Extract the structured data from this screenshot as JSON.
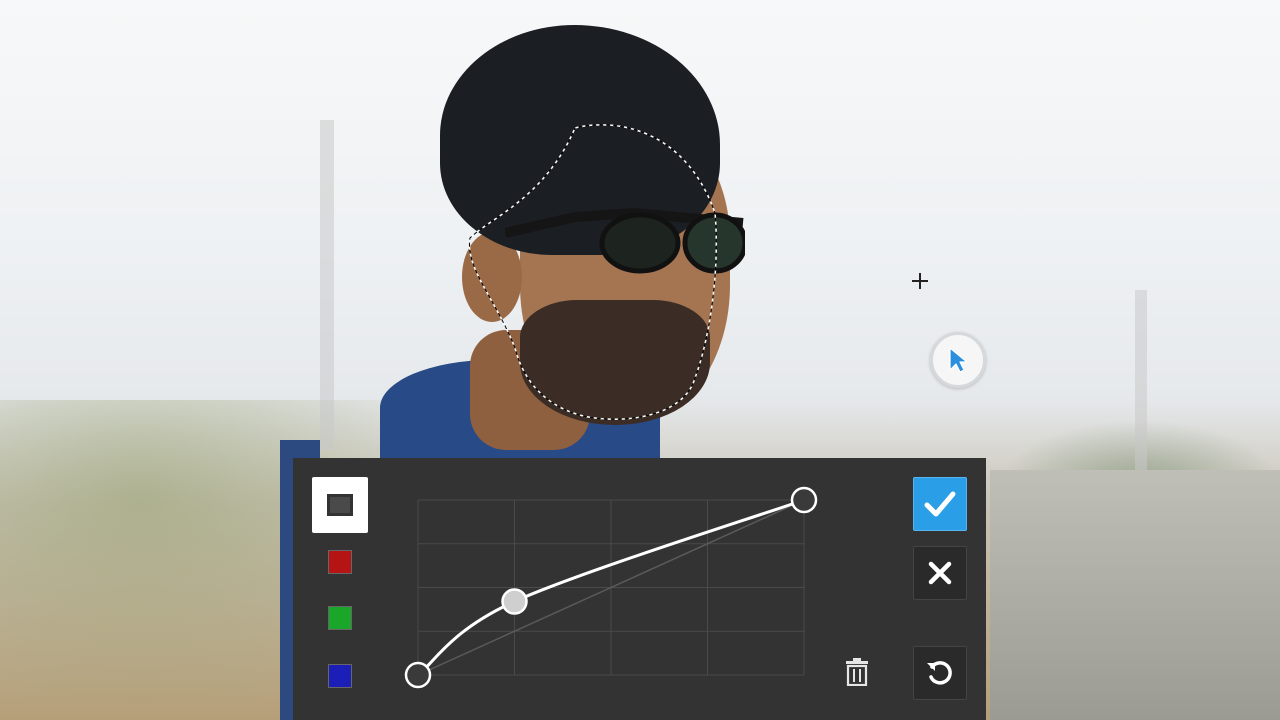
{
  "scene": {
    "photo_subject": "man-with-sunglasses",
    "colors": {
      "jacket": "#284a86",
      "panel_bg": "#333333",
      "accent": "#2a9ee7"
    }
  },
  "curves_panel": {
    "channels": [
      {
        "id": "rgb",
        "icon": "rgb-channel-icon",
        "selected": true,
        "color": "#333333"
      },
      {
        "id": "red",
        "icon": "red-channel-swatch",
        "selected": false,
        "color": "#b51414"
      },
      {
        "id": "green",
        "icon": "green-channel-swatch",
        "selected": false,
        "color": "#1aa628"
      },
      {
        "id": "blue",
        "icon": "blue-channel-swatch",
        "selected": false,
        "color": "#1b1fb8"
      }
    ],
    "curve_points": [
      {
        "input": 0,
        "output": 0
      },
      {
        "input": 0.25,
        "output": 0.42
      },
      {
        "input": 1,
        "output": 1
      }
    ],
    "actions": {
      "apply_icon": "checkmark-icon",
      "cancel_icon": "close-icon",
      "reset_icon": "reset-icon",
      "delete_icon": "trash-icon"
    }
  }
}
